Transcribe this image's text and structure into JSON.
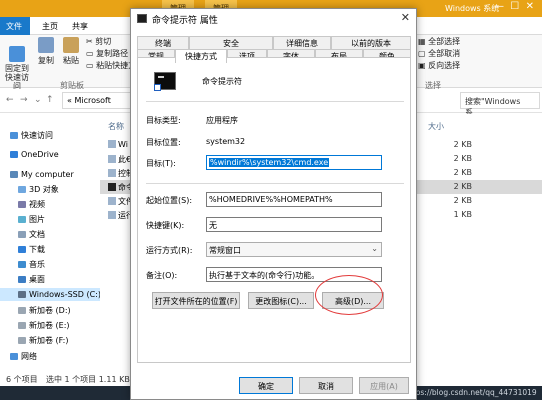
{
  "explorer": {
    "ribbon_manage_1": "管理",
    "ribbon_manage_2": "管理",
    "window_title": "Windows 系统",
    "tabs": [
      "文件",
      "主页",
      "共享"
    ],
    "ribbon": {
      "pin_label": "固定到\n快速访问",
      "copy_label": "复制",
      "paste_label": "粘贴",
      "cut": "剪切",
      "copy_path": "复制路径",
      "paste_shortcut": "粘贴快捷方",
      "clipboard_group": "剪贴板",
      "select_all": "全部选择",
      "select_none": "全部取消",
      "invert": "反向选择",
      "select_group": "选择"
    },
    "address": {
      "path": "« Microsoft",
      "search": "搜索\"Windows 系..."
    },
    "columns": {
      "name": "名称",
      "size": "大小"
    },
    "tree": [
      "快速访问",
      "OneDrive",
      "My computer",
      "3D 对象",
      "视频",
      "图片",
      "文档",
      "下载",
      "音乐",
      "桌面",
      "Windows-SSD (C:)",
      "新加卷 (D:)",
      "新加卷 (E:)",
      "新加卷 (F:)",
      "网络"
    ],
    "files": [
      {
        "name": "Wi",
        "size": "2 KB"
      },
      {
        "name": "此€",
        "size": "2 KB"
      },
      {
        "name": "控制",
        "size": "2 KB"
      },
      {
        "name": "命令",
        "size": "2 KB"
      },
      {
        "name": "文件",
        "size": "2 KB"
      },
      {
        "name": "运行",
        "size": "1 KB"
      }
    ],
    "status": {
      "items": "6 个项目",
      "selected": "选中 1 个项目  1.11 KB"
    },
    "watermark": "https://blog.csdn.net/qq_44731019"
  },
  "dialog": {
    "title": "命令提示符 属性",
    "tabs_row1": [
      "终端",
      "安全",
      "详细信息",
      "以前的版本"
    ],
    "tabs_row2": [
      "常规",
      "快捷方式",
      "选项",
      "字体",
      "布局",
      "颜色"
    ],
    "program_name": "命令提示符",
    "target_type_label": "目标类型:",
    "target_type_value": "应用程序",
    "target_location_label": "目标位置:",
    "target_location_value": "system32",
    "target_label": "目标(T):",
    "target_value": "%windir%\\system32\\cmd.exe",
    "start_in_label": "起始位置(S):",
    "start_in_value": "%HOMEDRIVE%%HOMEPATH%",
    "hotkey_label": "快捷键(K):",
    "hotkey_value": "无",
    "run_label": "运行方式(R):",
    "run_value": "常规窗口",
    "comment_label": "备注(O):",
    "comment_value": "执行基于文本的(命令行)功能。",
    "open_location_button": "打开文件所在的位置(F)",
    "change_icon_button": "更改图标(C)...",
    "advanced_button": "高级(D)...",
    "ok_button": "确定",
    "cancel_button": "取消",
    "apply_button": "应用(A)"
  },
  "colors": {
    "accent": "#0078d7",
    "explorer_title": "#e8a316",
    "annotation": "#e23b3b"
  }
}
